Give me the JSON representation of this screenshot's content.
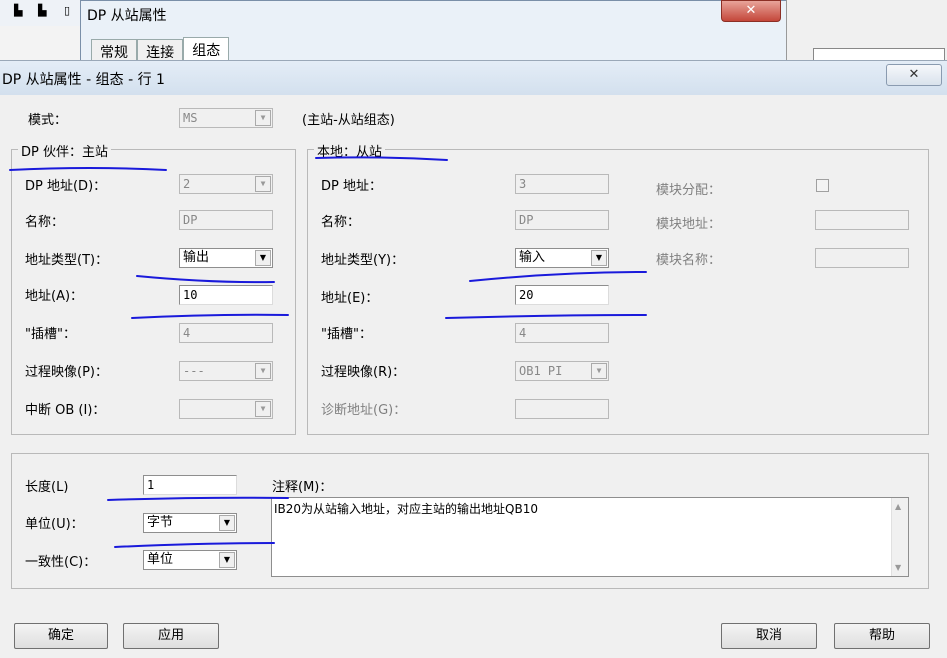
{
  "background_window": {
    "title": "DP 从站属性",
    "tabs": [
      "常规",
      "连接",
      "组态"
    ],
    "close_glyph": "✕"
  },
  "dialog": {
    "title": "DP 从站属性 - 组态 - 行 1",
    "close_glyph": "✕",
    "mode_label": "模式：",
    "mode_value": "MS",
    "mode_desc": "(主站-从站组态)",
    "partner": {
      "group_title": "DP 伙伴：主站",
      "dp_address_label": "DP 地址(D)：",
      "dp_address_value": "2",
      "name_label": "名称：",
      "name_value": "DP",
      "address_type_label": "地址类型(T)：",
      "address_type_value": "输出",
      "address_label": "地址(A)：",
      "address_value": "10",
      "slot_label": "\"插槽\"：",
      "slot_value": "4",
      "process_image_label": "过程映像(P)：",
      "process_image_value": "---",
      "interrupt_ob_label": "中断 OB (I)：",
      "interrupt_ob_value": ""
    },
    "local": {
      "group_title": "本地：从站",
      "dp_address_label": "DP 地址：",
      "dp_address_value": "3",
      "name_label": "名称：",
      "name_value": "DP",
      "address_type_label": "地址类型(Y)：",
      "address_type_value": "输入",
      "address_label": "地址(E)：",
      "address_value": "20",
      "slot_label": "\"插槽\"：",
      "slot_value": "4",
      "process_image_label": "过程映像(R)：",
      "process_image_value": "OB1 PI",
      "diag_address_label": "诊断地址(G)：",
      "diag_address_value": "",
      "module_assign_label": "模块分配：",
      "module_address_label": "模块地址：",
      "module_name_label": "模块名称："
    },
    "bottom": {
      "length_label": "长度(L)",
      "length_value": "1",
      "unit_label": "单位(U)：",
      "unit_value": "字节",
      "consistency_label": "一致性(C)：",
      "consistency_value": "单位",
      "comment_label": "注释(M)：",
      "comment_value": "IB20为从站输入地址，对应主站的输出地址QB10"
    },
    "buttons": {
      "ok": "确定",
      "apply": "应用",
      "cancel": "取消",
      "help": "帮助"
    }
  },
  "colors": {
    "annotation_ink": "#1a1adb",
    "dialog_bg": "#f0f0f0",
    "titlebar": "#d3e0ee"
  }
}
